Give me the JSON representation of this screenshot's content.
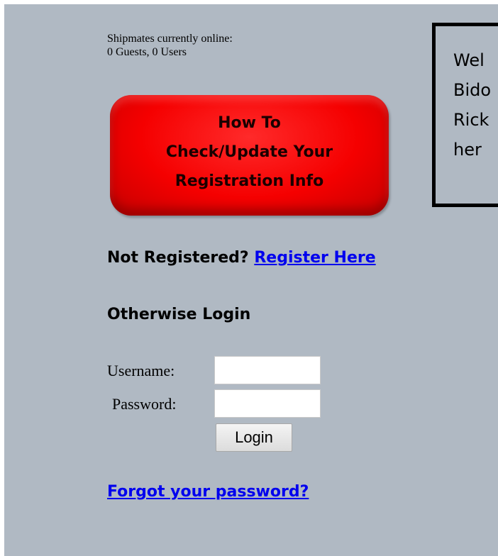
{
  "online": {
    "line1": "Shipmates currently online:",
    "line2": "0 Guests, 0 Users"
  },
  "howto_button": {
    "line1": "How To",
    "line2": "Check/Update Your",
    "line3": "Registration Info"
  },
  "welcome_box": {
    "lines": [
      "Wel",
      "Bido",
      "Rick",
      "her"
    ]
  },
  "registration": {
    "prompt": "Not Registered?",
    "link": "Register Here"
  },
  "login": {
    "heading": "Otherwise Login",
    "username_label": "Username:",
    "username_value": "",
    "password_label": "Password:",
    "password_value": "",
    "button_label": "Login",
    "forgot_link": "Forgot your password?"
  },
  "colors": {
    "background": "#b0b9c3",
    "button_red": "#f50000",
    "link_blue": "#0000ee"
  }
}
